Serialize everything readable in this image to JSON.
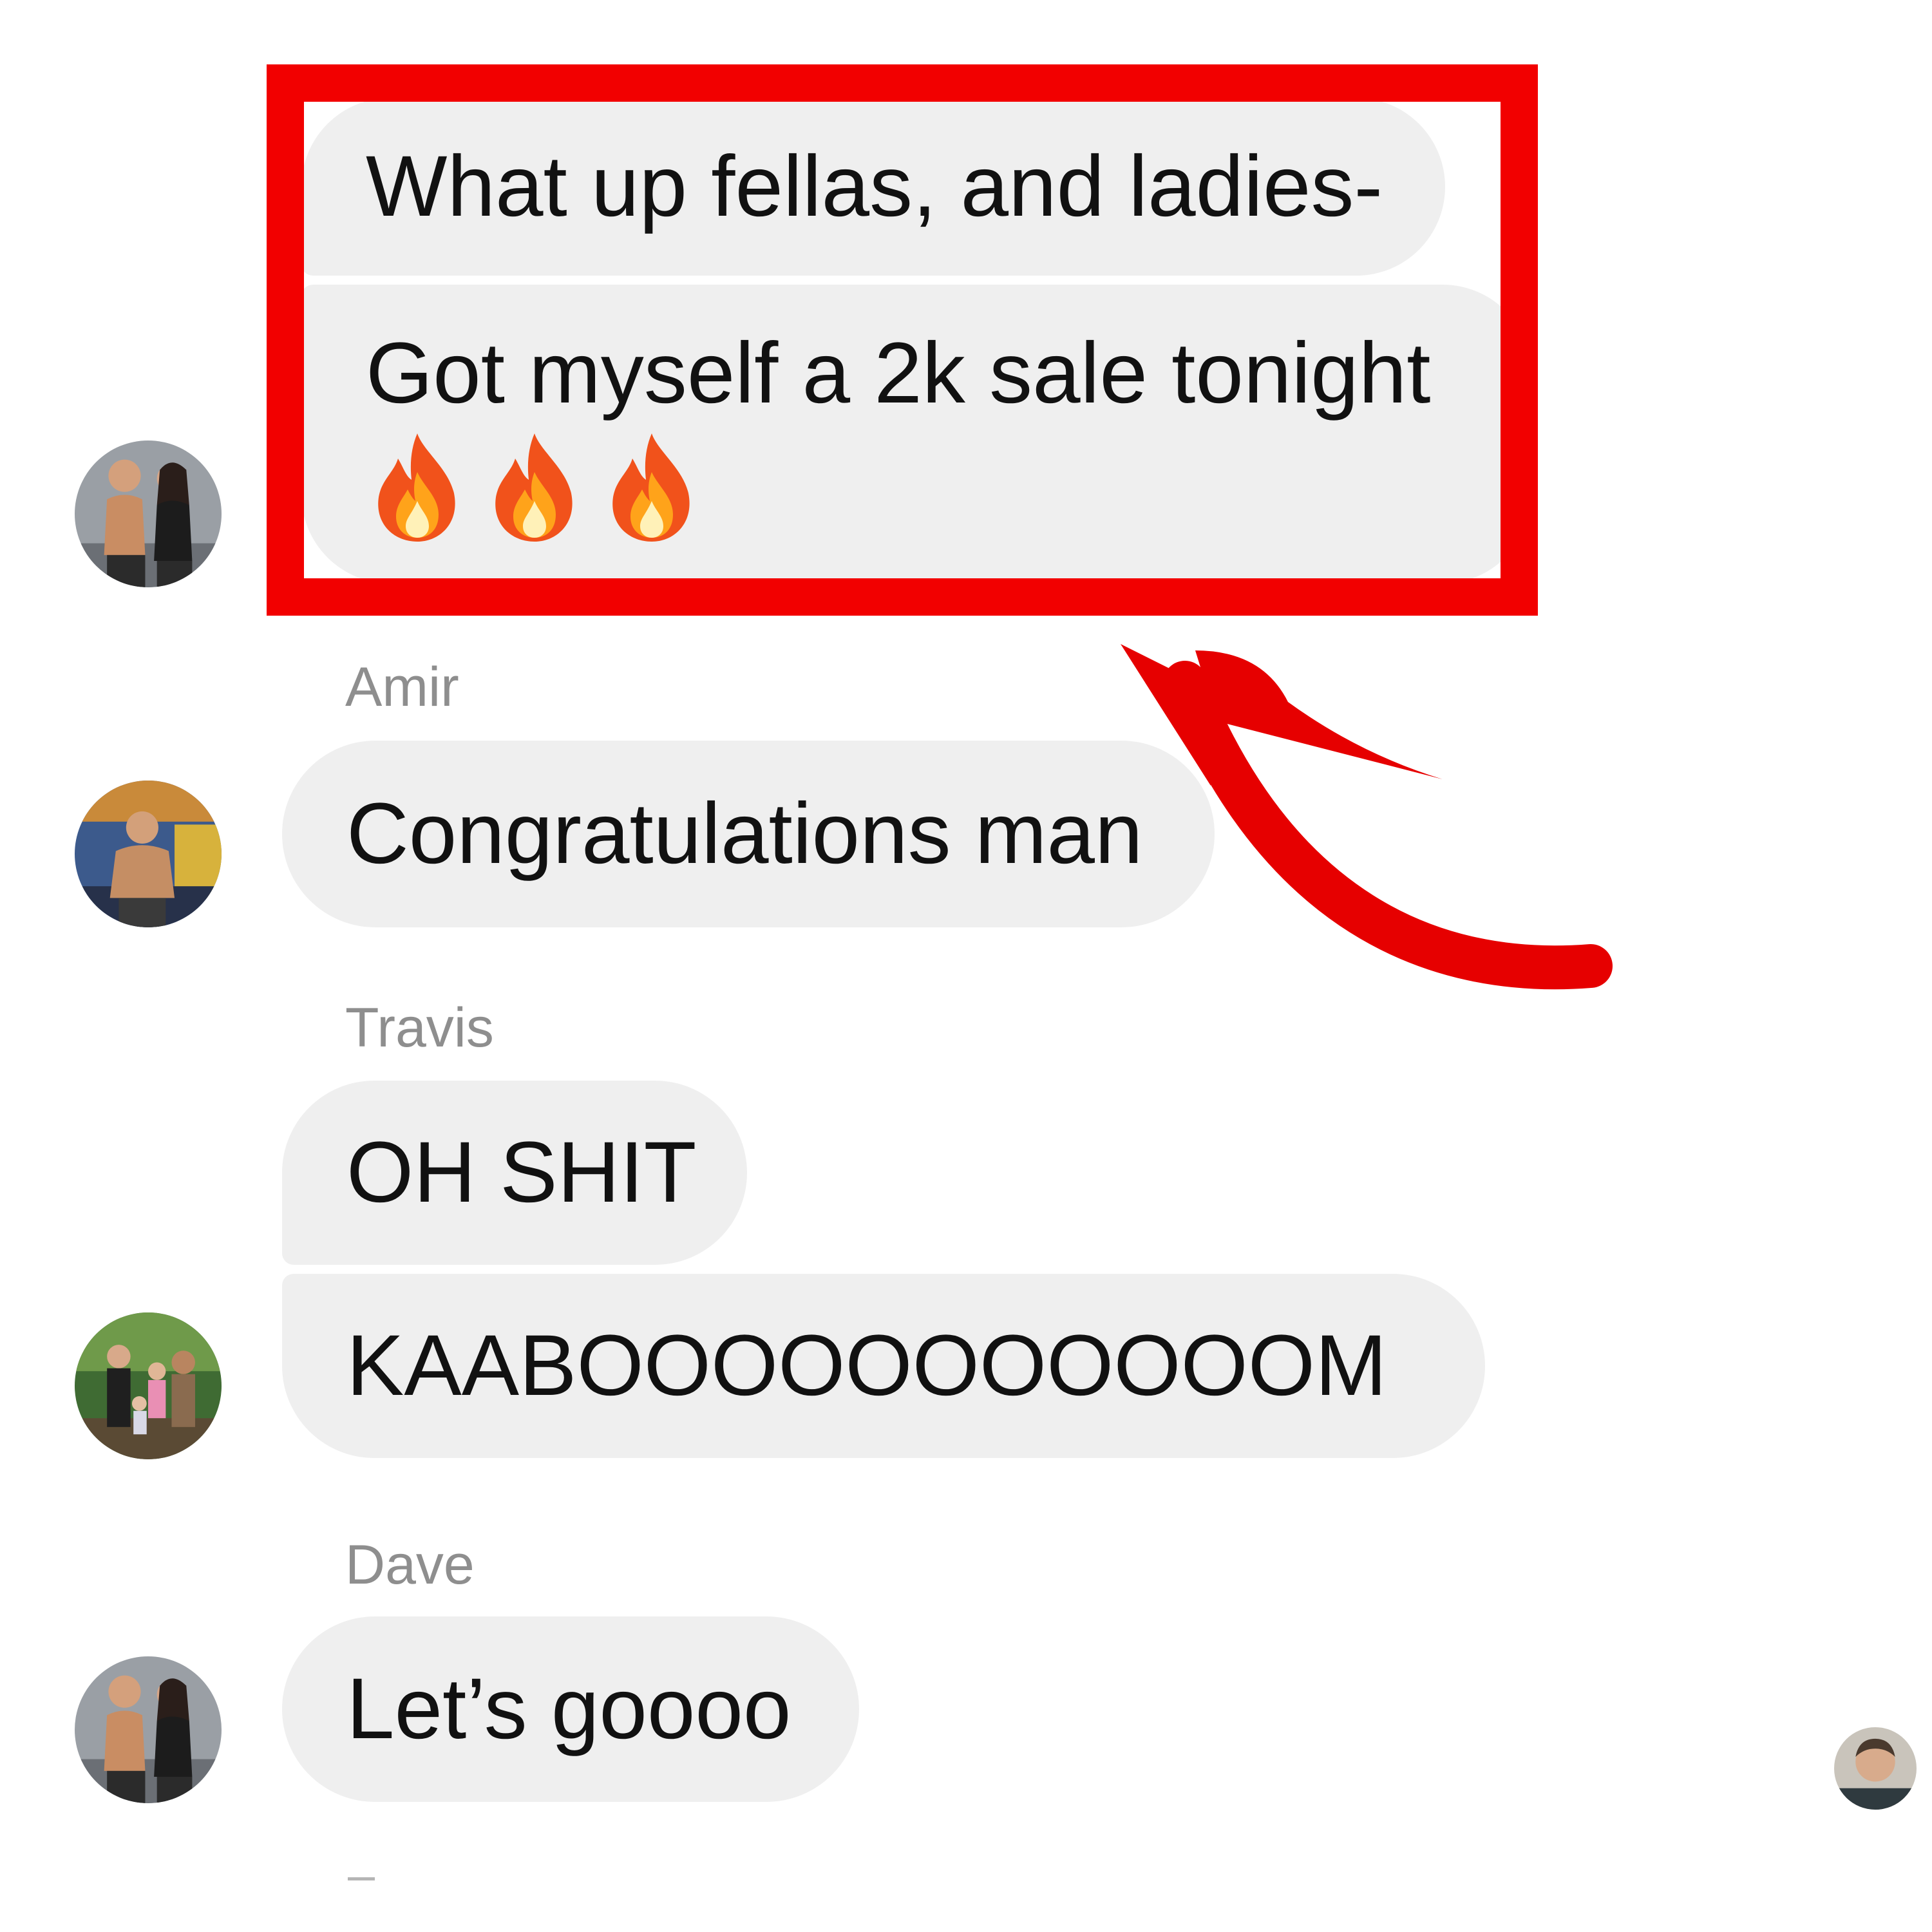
{
  "thread": {
    "groups": [
      {
        "sender": "",
        "messages": [
          "What up fellas, and ladies-",
          "Got myself a 2k sale tonight"
        ],
        "emoji": [
          "fire-icon",
          "fire-icon",
          "fire-icon"
        ]
      },
      {
        "sender": "Amir",
        "messages": [
          "Congratulations man"
        ]
      },
      {
        "sender": "Travis",
        "messages": [
          "OH SHIT",
          "KAABOOOOOOOOOOOM"
        ]
      },
      {
        "sender": "Dave",
        "messages": [
          "Let’s goooo"
        ]
      }
    ]
  },
  "annotation": {
    "highlight_color": "#f20000",
    "arrow_color": "#e60000"
  },
  "colors": {
    "bubble": "#efefef",
    "sender_name": "#8e8e8e",
    "text": "#111111"
  }
}
